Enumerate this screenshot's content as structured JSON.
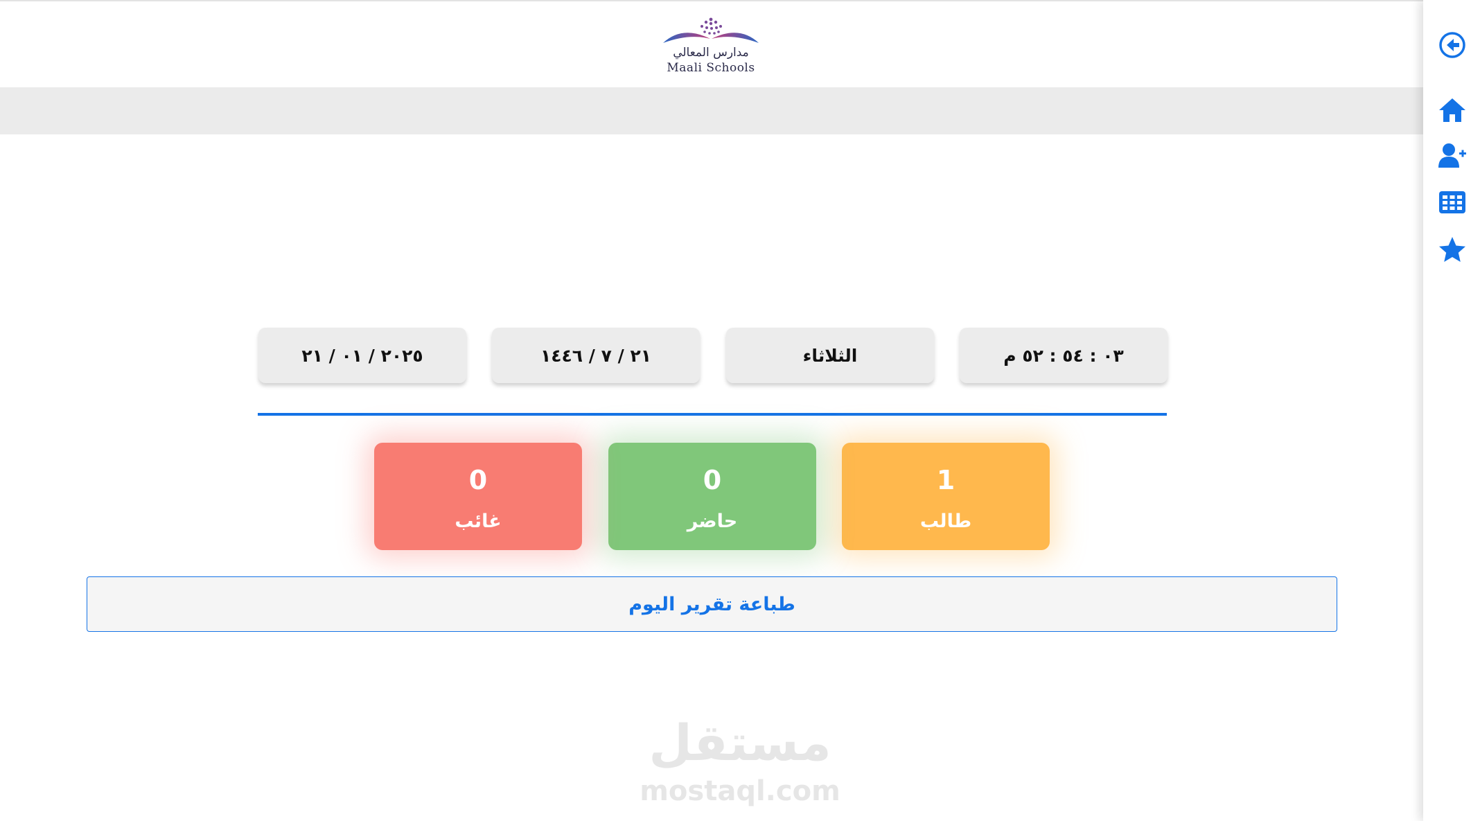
{
  "logo": {
    "arabic": "مدارس المعالي",
    "english": "Maali Schools"
  },
  "info_cards": {
    "time": "٠٣ : ٥٤ : ٥٢ م",
    "day": "الثلاثاء",
    "hijri_date": "٢١ / ٧ / ١٤٤٦",
    "gregorian_date": "٢٠٢٥ / ٠١ / ٢١"
  },
  "stats": {
    "students": {
      "value": "1",
      "label": "طالب"
    },
    "present": {
      "value": "0",
      "label": "حاضر"
    },
    "absent": {
      "value": "0",
      "label": "غائب"
    }
  },
  "print_button": {
    "label": "طباعة تقرير اليوم"
  },
  "watermark": {
    "arabic": "مستقل",
    "english": "mostaql.com"
  },
  "sidebar": {
    "icons": [
      "arrow-circle-left-icon",
      "home-icon",
      "user-plus-icon",
      "table-grid-icon",
      "star-icon"
    ],
    "accent": "#1473e6"
  },
  "colors": {
    "accent": "#1473e6",
    "students": "#ffb84d",
    "present": "#80c77a",
    "absent": "#f87c72"
  }
}
